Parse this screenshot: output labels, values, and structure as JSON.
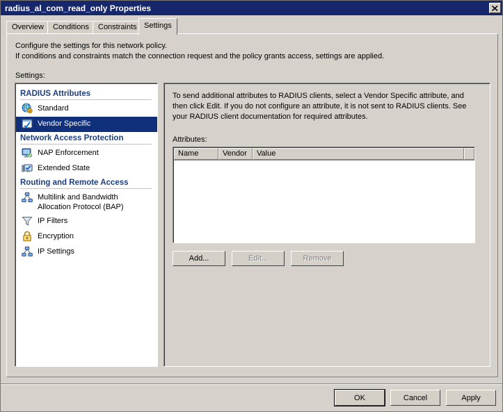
{
  "window": {
    "title": "radius_al_com_read_only Properties",
    "close_label": "Close",
    "close_icon": "close-icon"
  },
  "tabs": [
    {
      "label": "Overview",
      "active": false
    },
    {
      "label": "Conditions",
      "active": false
    },
    {
      "label": "Constraints",
      "active": false
    },
    {
      "label": "Settings",
      "active": true
    }
  ],
  "intro": {
    "line1": "Configure the settings for this network policy.",
    "line2": "If conditions and constraints match the connection request and the policy grants access, settings are applied.",
    "settings_label": "Settings:"
  },
  "tree": {
    "groups": [
      {
        "header": "RADIUS Attributes",
        "items": [
          {
            "label": "Standard",
            "icon": "globe-icon",
            "selected": false
          },
          {
            "label": "Vendor Specific",
            "icon": "window-check-icon",
            "selected": true
          }
        ]
      },
      {
        "header": "Network Access Protection",
        "items": [
          {
            "label": "NAP Enforcement",
            "icon": "monitor-check-icon",
            "selected": false
          },
          {
            "label": "Extended State",
            "icon": "monitor-state-icon",
            "selected": false
          }
        ]
      },
      {
        "header": "Routing and Remote Access",
        "items": [
          {
            "label": "Multilink and Bandwidth\nAllocation Protocol (BAP)",
            "icon": "network-nodes-icon",
            "selected": false
          },
          {
            "label": "IP Filters",
            "icon": "funnel-icon",
            "selected": false
          },
          {
            "label": "Encryption",
            "icon": "padlock-icon",
            "selected": false
          },
          {
            "label": "IP Settings",
            "icon": "network-nodes-icon",
            "selected": false
          }
        ]
      }
    ]
  },
  "details": {
    "description": "To send additional attributes to RADIUS clients, select a Vendor Specific attribute, and then click Edit. If you do not configure an attribute, it is not sent to RADIUS clients. See your RADIUS client documentation for required attributes.",
    "attributes_label": "Attributes:",
    "table": {
      "columns": [
        "Name",
        "Vendor",
        "Value"
      ],
      "rows": []
    },
    "buttons": [
      {
        "label": "Add...",
        "enabled": true
      },
      {
        "label": "Edit...",
        "enabled": false
      },
      {
        "label": "Remove",
        "enabled": false
      }
    ]
  },
  "footer": {
    "buttons": [
      {
        "label": "OK",
        "enabled": true,
        "default": true
      },
      {
        "label": "Cancel",
        "enabled": true,
        "default": false
      },
      {
        "label": "Apply",
        "enabled": true,
        "default": false
      }
    ]
  }
}
